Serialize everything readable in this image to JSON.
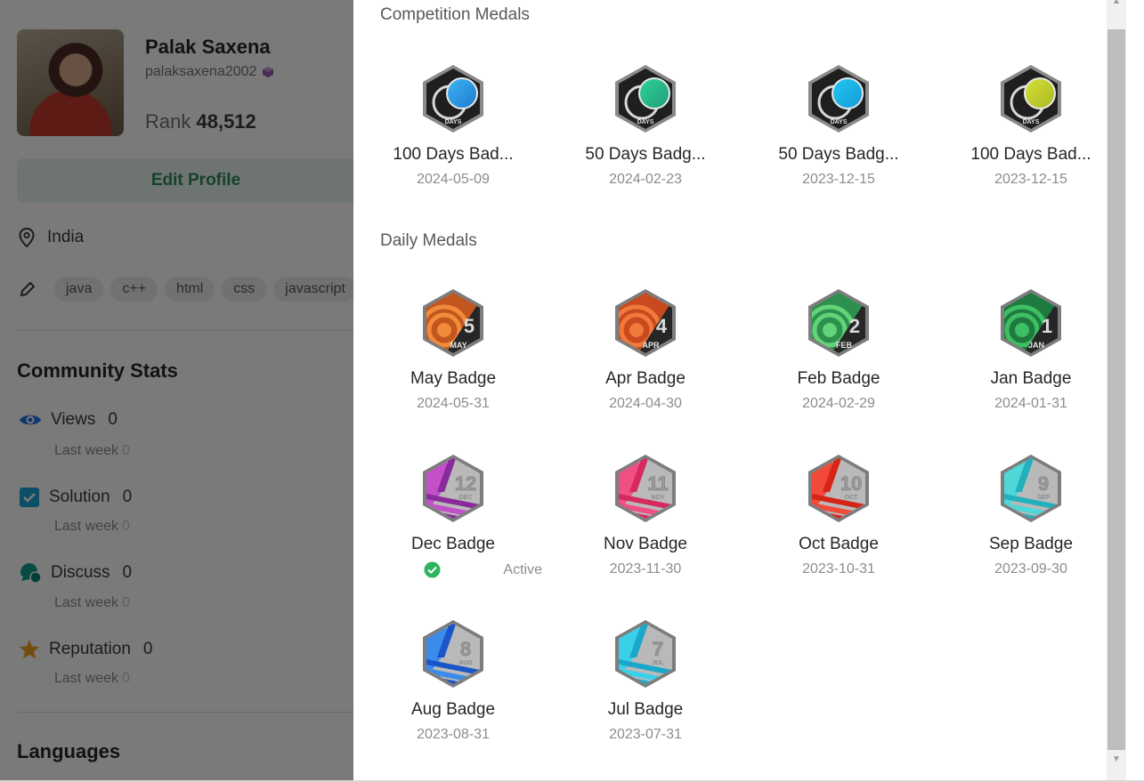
{
  "profile": {
    "name": "Palak Saxena",
    "username": "palaksaxena2002",
    "rank_label": "Rank",
    "rank_value": "48,512",
    "edit_label": "Edit Profile",
    "location": "India",
    "skills": [
      "java",
      "c++",
      "html",
      "css",
      "javascript"
    ]
  },
  "community": {
    "title": "Community Stats",
    "stats": [
      {
        "label": "Views",
        "value": "0",
        "sub_label": "Last week",
        "sub_value": "0",
        "icon": "eye-icon",
        "color": "#1a73e8"
      },
      {
        "label": "Solution",
        "value": "0",
        "sub_label": "Last week",
        "sub_value": "0",
        "icon": "checkbox-icon",
        "color": "#1aa3d9"
      },
      {
        "label": "Discuss",
        "value": "0",
        "sub_label": "Last week",
        "sub_value": "0",
        "icon": "chat-icon",
        "color": "#0f9d8f"
      },
      {
        "label": "Reputation",
        "value": "0",
        "sub_label": "Last week",
        "sub_value": "0",
        "icon": "star-icon",
        "color": "#f0a020"
      }
    ]
  },
  "languages": {
    "title": "Languages"
  },
  "modal": {
    "competition_title": "Competition Medals",
    "daily_title": "Daily Medals",
    "competition": [
      {
        "name": "100 Days Bad...",
        "date": "2024-05-09",
        "badge_text": "DAYS",
        "color1": "#3fb6f2",
        "color2": "#1e78d0"
      },
      {
        "name": "50 Days Badg...",
        "date": "2024-02-23",
        "badge_text": "DAYS",
        "color1": "#2fd39b",
        "color2": "#1f9c78"
      },
      {
        "name": "50 Days Badg...",
        "date": "2023-12-15",
        "badge_text": "DAYS",
        "color1": "#20c8f2",
        "color2": "#1699d6"
      },
      {
        "name": "100 Days Bad...",
        "date": "2023-12-15",
        "badge_text": "DAYS",
        "color1": "#d6e03a",
        "color2": "#a9b820"
      }
    ],
    "daily": [
      {
        "name": "May Badge",
        "date": "2024-05-31",
        "num": "5",
        "month": "MAY",
        "color1": "#f28b3c",
        "color2": "#c2561e",
        "style": "ring"
      },
      {
        "name": "Apr Badge",
        "date": "2024-04-30",
        "num": "4",
        "month": "APR",
        "color1": "#f07a3c",
        "color2": "#c94a1e",
        "style": "ring"
      },
      {
        "name": "Feb Badge",
        "date": "2024-02-29",
        "num": "2",
        "month": "FEB",
        "color1": "#63d37a",
        "color2": "#2e8f4f",
        "style": "ring"
      },
      {
        "name": "Jan Badge",
        "date": "2024-01-31",
        "num": "1",
        "month": "JAN",
        "color1": "#3fbf63",
        "color2": "#1f7a3f",
        "style": "ring"
      },
      {
        "name": "Dec Badge",
        "date": "Active",
        "num": "12",
        "month": "DEC",
        "color1": "#c34fc9",
        "color2": "#8a2b9c",
        "style": "stripe",
        "active": true
      },
      {
        "name": "Nov Badge",
        "date": "2023-11-30",
        "num": "11",
        "month": "NOV",
        "color1": "#f04f83",
        "color2": "#d62a5e",
        "style": "stripe"
      },
      {
        "name": "Oct Badge",
        "date": "2023-10-31",
        "num": "10",
        "month": "OCT",
        "color1": "#f24a3a",
        "color2": "#d62416",
        "style": "stripe"
      },
      {
        "name": "Sep Badge",
        "date": "2023-09-30",
        "num": "9",
        "month": "SEP",
        "color1": "#4fd6d6",
        "color2": "#23b0bd",
        "style": "stripe"
      },
      {
        "name": "Aug Badge",
        "date": "2023-08-31",
        "num": "8",
        "month": "AUG",
        "color1": "#3a8bea",
        "color2": "#1a55c9",
        "style": "stripe"
      },
      {
        "name": "Jul Badge",
        "date": "2023-07-31",
        "num": "7",
        "month": "JUL",
        "color1": "#3ad0ea",
        "color2": "#1aa7c9",
        "style": "stripe"
      }
    ]
  }
}
